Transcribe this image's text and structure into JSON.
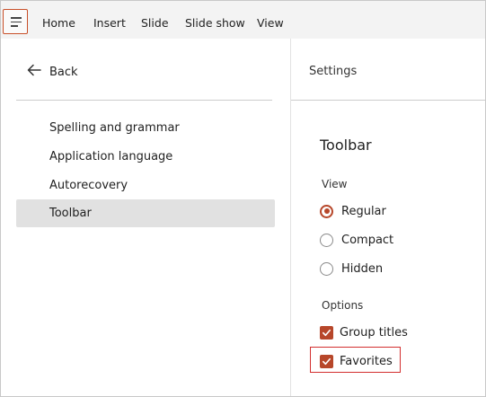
{
  "ribbon": {
    "tabs": [
      {
        "label": "Home"
      },
      {
        "label": "Insert"
      },
      {
        "label": "Slide"
      },
      {
        "label": "Slide show"
      },
      {
        "label": "View"
      }
    ]
  },
  "left_pane": {
    "back_label": "Back",
    "items": [
      {
        "label": "Spelling and grammar"
      },
      {
        "label": "Application language"
      },
      {
        "label": "Autorecovery"
      },
      {
        "label": "Toolbar"
      }
    ],
    "selected_item": "Toolbar"
  },
  "right_pane": {
    "title": "Settings",
    "heading": "Toolbar",
    "view": {
      "label": "View",
      "options": [
        {
          "label": "Regular",
          "checked": true
        },
        {
          "label": "Compact",
          "checked": false
        },
        {
          "label": "Hidden",
          "checked": false
        }
      ]
    },
    "options": {
      "label": "Options",
      "checkboxes": [
        {
          "label": "Group titles",
          "checked": true
        },
        {
          "label": "Favorites",
          "checked": true
        }
      ]
    }
  },
  "colors": {
    "accent": "#b7472a",
    "highlight": "#d32f2f",
    "selected_bg": "#e1e1e1"
  },
  "icons": {
    "menu": "hamburger-menu-icon",
    "back": "arrow-left-icon",
    "check": "checkmark-icon"
  }
}
